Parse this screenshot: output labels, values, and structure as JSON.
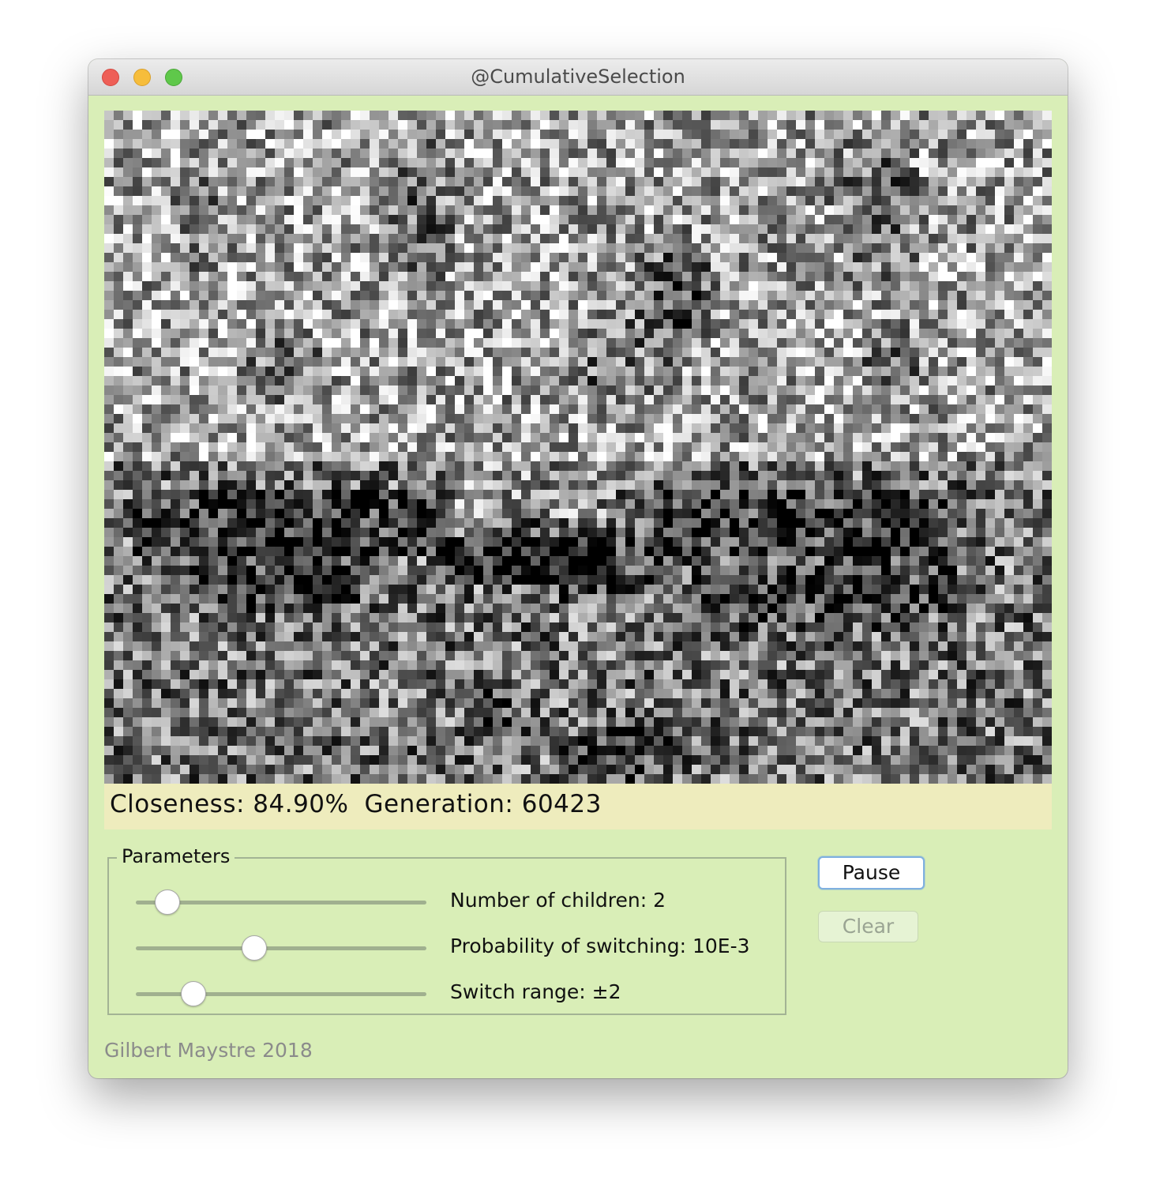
{
  "window": {
    "title": "@CumulativeSelection"
  },
  "status": {
    "closeness": "Closeness: 84.90%",
    "generation": "Generation: 60423"
  },
  "parameters": {
    "legend": "Parameters",
    "sliders": [
      {
        "label": "Number of children: 2",
        "level": 0.07
      },
      {
        "label": "Probability of switching: 10E-3",
        "level": 0.4
      },
      {
        "label": "Switch range: ±2",
        "level": 0.17
      }
    ]
  },
  "buttons": {
    "pause": "Pause",
    "clear": "Clear"
  },
  "footer": {
    "credit": "Gilbert Maystre 2018"
  },
  "colors": {
    "background": "#d9eeb7",
    "status_bar": "#eeecbd",
    "pause_border": "#7fb0e0"
  }
}
